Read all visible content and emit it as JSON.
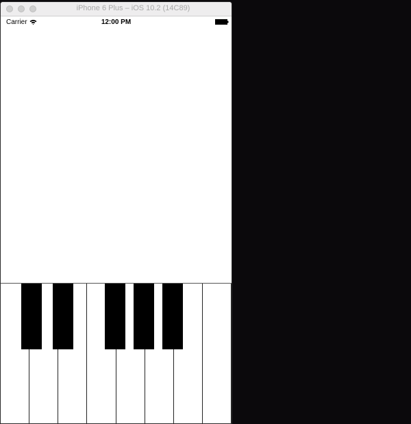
{
  "window": {
    "title": "iPhone 6 Plus – iOS 10.2 (14C89)"
  },
  "status_bar": {
    "carrier": "Carrier",
    "time": "12:00 PM"
  },
  "piano": {
    "white_keys": 8,
    "black_keys": 5,
    "key_colors": {
      "white": "#ffffff",
      "black": "#000000",
      "divider": "#222222"
    }
  },
  "colors": {
    "desktop_background": "#0b090c",
    "titlebar": "#eeedee",
    "title_text": "#a9a9a9"
  }
}
